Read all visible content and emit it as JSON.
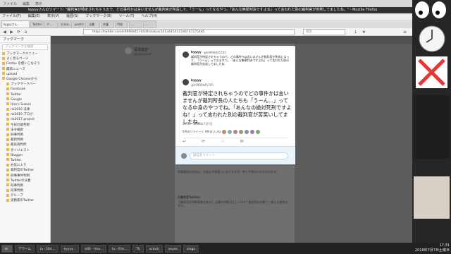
{
  "window": {
    "title": "kyyyyさんのツイート: \"裁判官が特定されちゃうので、どの事件かは言いませんが裁判官が所長して、「うーん」ってなるやつ。「あんな無罪判決ですよね」って言われた別の裁判官が苦笑してましたね。\" - Mozilla Firefox",
    "menu": [
      "ファイル(F)",
      "編集(E)",
      "表示(V)",
      "履歴(S)",
      "ブックマーク(B)",
      "ツール(T)",
      "ヘルプ(H)"
    ],
    "top_strip": [
      "ファイル",
      "編集",
      "表示"
    ]
  },
  "tabs": [
    "kyyyyさん",
    "Twitter",
    "ア...",
    "大半の...",
    "yoshili",
    "法曹",
    "弁護",
    "門池",
    "...",
    "..."
  ],
  "nav": {
    "url": "https://twitter.com/k9999445705ll9/status/1013445011546707275485",
    "search_placeholder": "検索"
  },
  "sidebar": {
    "title": "ブックマーク",
    "search_placeholder": "ブックマークを検索",
    "items": [
      "ブックマークメニュー",
      "よく見るページ",
      "Firefox を使いこなそう",
      "最新ニュース",
      "upload",
      "Google Chromeから",
      "ブックマークバー",
      "Facebook",
      "Twitter",
      "Google",
      "Hiro's Suzuki",
      "nk2016 法律",
      "nk2019 ブログ",
      "nk2017 project",
      "今日の裁判例",
      "法令検索",
      "刑事判例",
      "最新判例",
      "最高裁判所",
      "ダイジェスト",
      "Blogger",
      "Twitter",
      "お気に入り",
      "裁判官のTwitter",
      "刑事事件判例",
      "Twitterの法曹",
      "刑事判例",
      "民事判例",
      "グループ",
      "実務家のTwitter"
    ]
  },
  "profile": {
    "name": "深澤諭史",
    "handle": "@fukazawas"
  },
  "modal": {
    "author_name": "kyyyy",
    "author_handle": "@k9999445705",
    "tweet_small": "裁判官が特定されちゃうので、どの事件かは言いませんが裁判官が所長になって、「うーん」ってなるやつ。「あんな無罪判決ですよね」って言われた別の裁判官が苦笑してましたね",
    "retweeter": "kyyyy",
    "quote_text": "裁判官が特定されちゃうのでどの事件かは言いませんが裁判所長の人たちも「うーん...」ってなる中身のやつでね。「あんなの絶対死刑ですよね！」って言われた別の裁判官が苦笑いしてましたね。",
    "date": "20:16 - 2018年7月7日",
    "likes_label": "5件のリツイート  9件のいいね",
    "actions": [
      "↩",
      "⟳",
      "♡",
      "✉"
    ],
    "reply_placeholder": "返信をツイート"
  },
  "background": {
    "block1": "刑事裁判の判決は、大体は予想通りになりますが、時々予想外のものが出ます。",
    "block2_name": "元裁判官Twitter",
    "block2": "【裁判官の判断基準を探る】 法曹の判断は正しいのか? 裁判官の判断と一般人の感覚のずれ。"
  },
  "taskbar": {
    "items": [
      "アラーム",
      "tv - Dol...",
      "kyyyy...",
      "e66 - Ima...",
      "tv - Fire...",
      "Tk",
      "xclock",
      "xeyes",
      "xlogo"
    ],
    "time": "17:31",
    "date": "2018年7月7日土曜日"
  },
  "colors": {
    "dim": "#5c5c5c",
    "reply": "#e8f3fb",
    "accent": "#1da1f2"
  }
}
